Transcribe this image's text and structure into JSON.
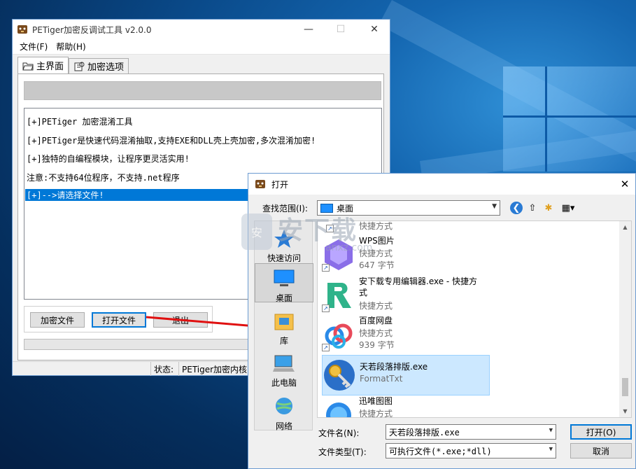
{
  "main_window": {
    "title": "PETiger加密反调试工具 v2.0.0",
    "menu": [
      "文件(F)",
      "帮助(H)"
    ],
    "tabs": [
      "主界面",
      "加密选项"
    ],
    "log_lines": [
      "[+]PETiger 加密混淆工具",
      "[+]PETiger是快速代码混淆抽取,支持EXE和DLL壳上壳加密,多次混淆加密!",
      "[+]独特的自编程模块，让程序更灵活实用!",
      "注意:不支持64位程序，不支持.net程序",
      "[+]-->请选择文件!"
    ],
    "buttons": {
      "encrypt": "加密文件",
      "open": "打开文件",
      "exit": "退出"
    },
    "status": {
      "label": "状态:",
      "value": "PETiger加密内核"
    }
  },
  "open_dialog": {
    "title": "打开",
    "lookin_label": "查找范围(I):",
    "lookin_value": "桌面",
    "places": [
      "快速访问",
      "桌面",
      "库",
      "此电脑",
      "网络"
    ],
    "files": [
      {
        "name": "",
        "type": "快捷方式",
        "size": ""
      },
      {
        "name": "WPS图片",
        "type": "快捷方式",
        "size": "647 字节"
      },
      {
        "name": "安下载专用编辑器.exe - 快捷方式",
        "type": "快捷方式",
        "size": ""
      },
      {
        "name": "百度网盘",
        "type": "快捷方式",
        "size": "939 字节"
      },
      {
        "name": "天若段落排版.exe",
        "type": "FormatTxt",
        "size": ""
      },
      {
        "name": "迅唯图图",
        "type": "快捷方式",
        "size": ""
      }
    ],
    "filename_label": "文件名(N):",
    "filename_value": "天若段落排版.exe",
    "filetype_label": "文件类型(T):",
    "filetype_value": "可执行文件(*.exe;*dll)",
    "open_button": "打开(O)",
    "cancel_button": "取消"
  },
  "watermark": {
    "text": "安下载",
    "sub": "anxz.com",
    "badge": "安"
  },
  "colors": {
    "selection": "#0078d7",
    "accent_arrow": "#e01010"
  }
}
